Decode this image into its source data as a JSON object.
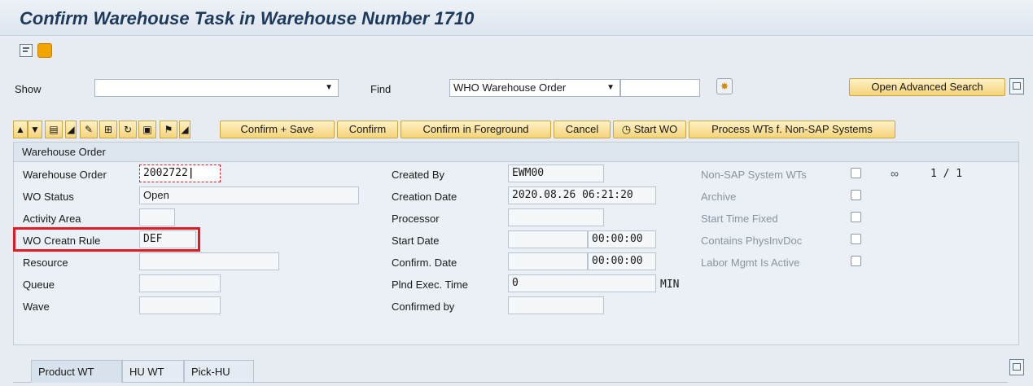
{
  "header": {
    "title": "Confirm Warehouse Task in Warehouse Number 1710"
  },
  "search_bar": {
    "show_label": "Show",
    "show_value": "",
    "find_label": "Find",
    "find_value": "WHO Warehouse Order",
    "find_input": "",
    "advanced_search_label": "Open Advanced Search"
  },
  "toolbar": {
    "confirm_save": "Confirm + Save",
    "confirm": "Confirm",
    "confirm_foreground": "Confirm in Foreground",
    "cancel": "Cancel",
    "start_wo": "Start WO",
    "process_wts": "Process WTs f. Non-SAP Systems"
  },
  "warehouse_order": {
    "section_title": "Warehouse Order",
    "left": [
      {
        "label": "Warehouse Order",
        "value": "2002722"
      },
      {
        "label": "WO Status",
        "value": "Open"
      },
      {
        "label": "Activity Area",
        "value": ""
      },
      {
        "label": "WO Creatn Rule",
        "value": "DEF"
      },
      {
        "label": "Resource",
        "value": ""
      },
      {
        "label": "Queue",
        "value": ""
      },
      {
        "label": "Wave",
        "value": ""
      }
    ],
    "middle": [
      {
        "label": "Created By",
        "value": "EWM00"
      },
      {
        "label": "Creation Date",
        "value": "2020.08.26",
        "time": "06:21:20"
      },
      {
        "label": "Processor",
        "value": ""
      },
      {
        "label": "Start Date",
        "value": "",
        "time": "00:00:00"
      },
      {
        "label": "Confirm. Date",
        "value": "",
        "time": "00:00:00"
      },
      {
        "label": "Plnd Exec. Time",
        "value": "0",
        "unit": "MIN"
      },
      {
        "label": "Confirmed by",
        "value": ""
      }
    ],
    "right": [
      {
        "label": "Non-SAP System WTs",
        "checked": false
      },
      {
        "label": "Archive",
        "checked": false
      },
      {
        "label": "Start Time Fixed",
        "checked": false
      },
      {
        "label": "Contains PhysInvDoc",
        "checked": false
      },
      {
        "label": "Labor Mgmt Is Active",
        "checked": false
      }
    ],
    "pager": "1 / 1"
  },
  "tabs": [
    {
      "label": "Product WT"
    },
    {
      "label": "HU WT"
    },
    {
      "label": "Pick-HU"
    }
  ],
  "colors": {
    "highlight": "#e21b23",
    "button": "#f4d37a",
    "panel": "#eaf0f6"
  }
}
